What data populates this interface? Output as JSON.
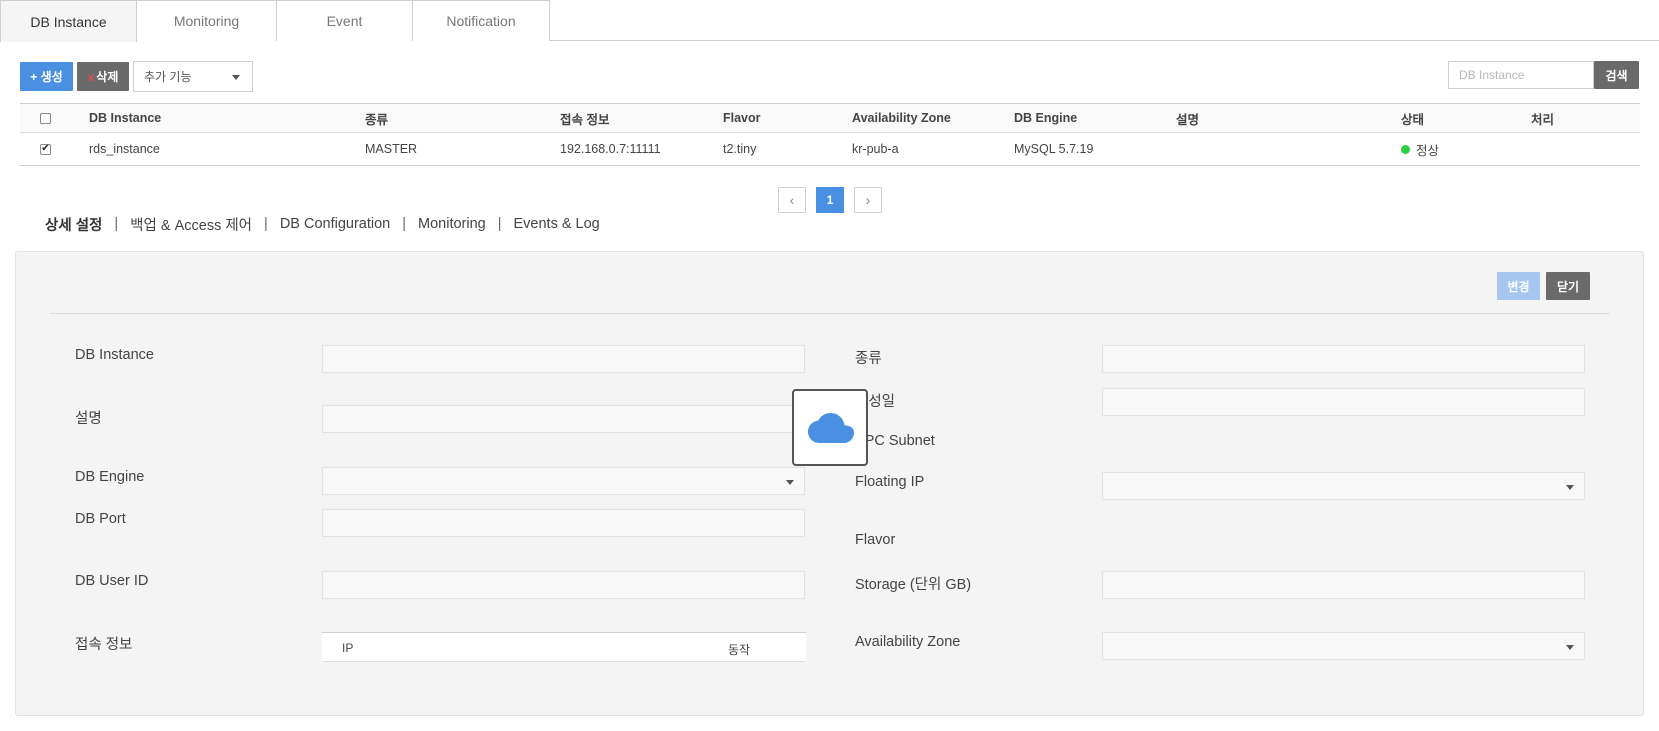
{
  "tabs": [
    "DB Instance",
    "Monitoring",
    "Event",
    "Notification"
  ],
  "toolbar": {
    "create_label": "+ 생성",
    "delete_x": "x",
    "delete_label": "삭제",
    "more_select": "추가 기능",
    "search_placeholder": "DB Instance",
    "search_button": "검색"
  },
  "table": {
    "headers": [
      "DB Instance",
      "종류",
      "접속 정보",
      "Flavor",
      "Availability Zone",
      "DB Engine",
      "설명",
      "상태",
      "처리"
    ],
    "rows": [
      {
        "checked": true,
        "name": "rds_instance",
        "type": "MASTER",
        "connection": "192.168.0.7:11111",
        "flavor": "t2.tiny",
        "zone": "kr-pub-a",
        "engine": "MySQL 5.7.19",
        "description": "",
        "status": "정상",
        "status_color": "#2ecc40",
        "action": ""
      }
    ]
  },
  "pagination": {
    "prev": "‹",
    "page": "1",
    "next": "›"
  },
  "detail_nav": [
    "상세 설정",
    "백업 & Access 제어",
    "DB Configuration",
    "Monitoring",
    "Events & Log"
  ],
  "detail_nav_sep": "|",
  "panel": {
    "change_button": "변경",
    "close_button": "닫기",
    "left_labels": {
      "instance": "DB Instance",
      "description": "설명",
      "engine": "DB Engine",
      "port": "DB Port",
      "user_id": "DB User ID",
      "connection": "접속 정보"
    },
    "right_labels": {
      "type": "종류",
      "created": "생성일",
      "subnet": "VPC Subnet",
      "floating_ip": "Floating IP",
      "flavor": "Flavor",
      "storage": "Storage (단위 GB)",
      "zone": "Availability Zone"
    },
    "connection_table": {
      "ip_header": "IP",
      "action_header": "동작"
    }
  },
  "colors": {
    "primary": "#4a90e2",
    "dark_button": "#6a6a6a",
    "disabled_primary": "#a5c7ef",
    "status_ok": "#2ecc40",
    "cloud": "#4a90e2"
  }
}
